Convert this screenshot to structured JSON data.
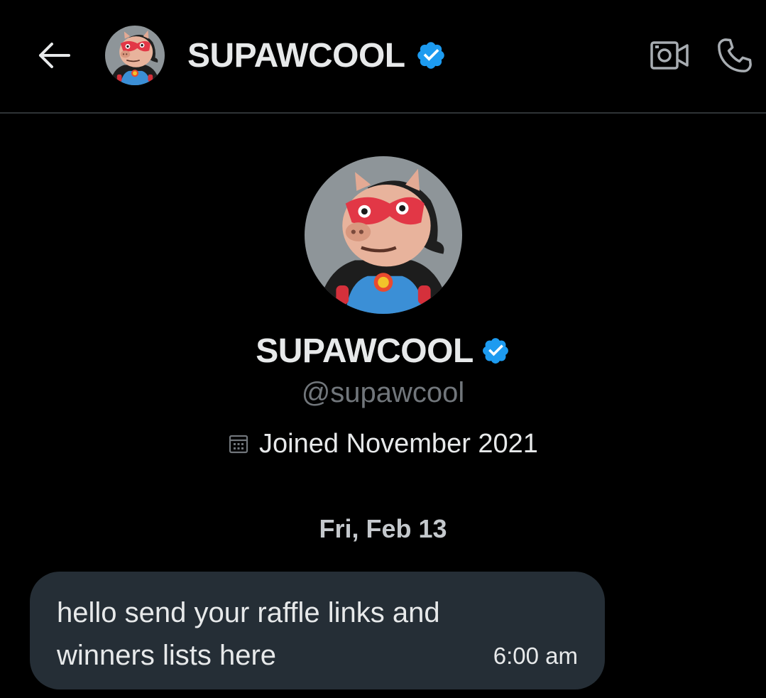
{
  "header": {
    "name": "SUPAWCOOL",
    "back_icon": "back-arrow-icon",
    "verified_icon": "verified-badge-icon",
    "video_icon": "video-call-icon",
    "call_icon": "phone-icon"
  },
  "profile": {
    "name": "SUPAWCOOL",
    "handle": "@supawcool",
    "joined": "Joined November 2021",
    "calendar_icon": "calendar-icon"
  },
  "conversation": {
    "date_separator": "Fri, Feb 13",
    "messages": [
      {
        "text": "hello send your raffle links and winners lists here",
        "time": "6:00 am"
      }
    ]
  },
  "colors": {
    "background": "#000000",
    "divider": "#2f3336",
    "verified": "#1d9bf0",
    "bubble": "#252e36",
    "secondary_text": "#71767b"
  }
}
